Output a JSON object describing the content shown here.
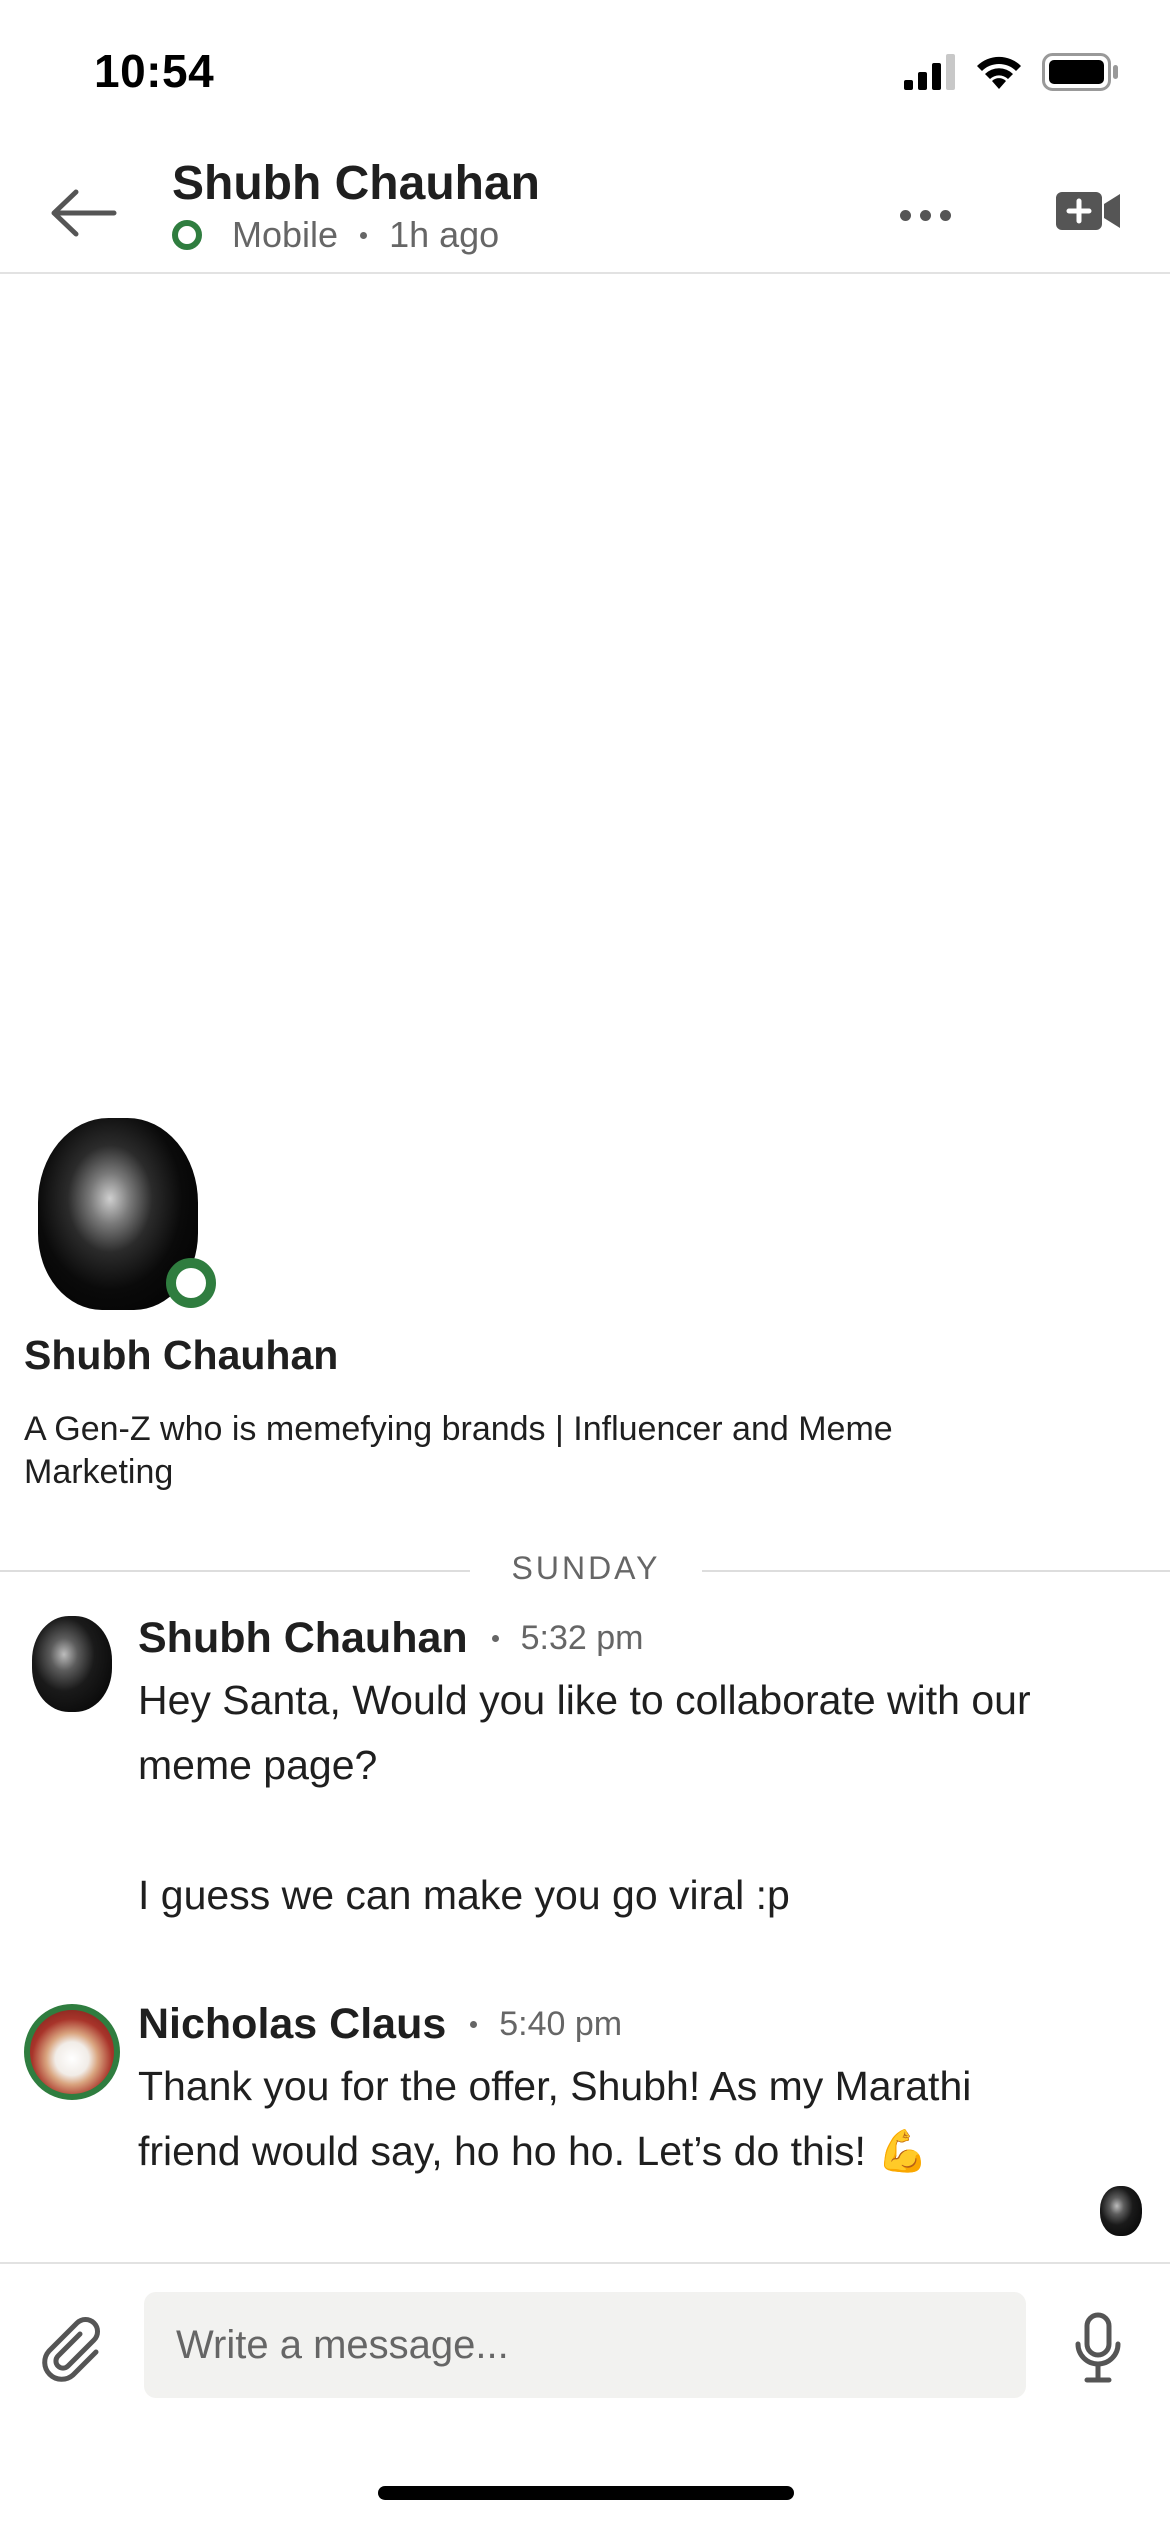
{
  "status_bar": {
    "time": "10:54"
  },
  "header": {
    "contact_name": "Shubh Chauhan",
    "status_device": "Mobile",
    "status_time": "1h ago"
  },
  "profile": {
    "name": "Shubh Chauhan",
    "headline": "A Gen-Z who is memefying brands | Influencer and Meme Marketing"
  },
  "divider": {
    "label": "SUNDAY"
  },
  "messages": [
    {
      "sender": "Shubh Chauhan",
      "time": "5:32 pm",
      "text": "Hey Santa, Would you like to collaborate with our meme page?\n\nI guess we can make you go viral :p"
    },
    {
      "sender": "Nicholas Claus",
      "time": "5:40 pm",
      "text": "Thank you for the offer, Shubh! As my Marathi friend would say, ho ho ho. Let’s do this! 💪"
    }
  ],
  "composer": {
    "placeholder": "Write a message..."
  },
  "colors": {
    "online_green": "#2f7d3f",
    "text": "#1f1f1f",
    "muted": "#666666",
    "divider": "#e2e2e2"
  }
}
